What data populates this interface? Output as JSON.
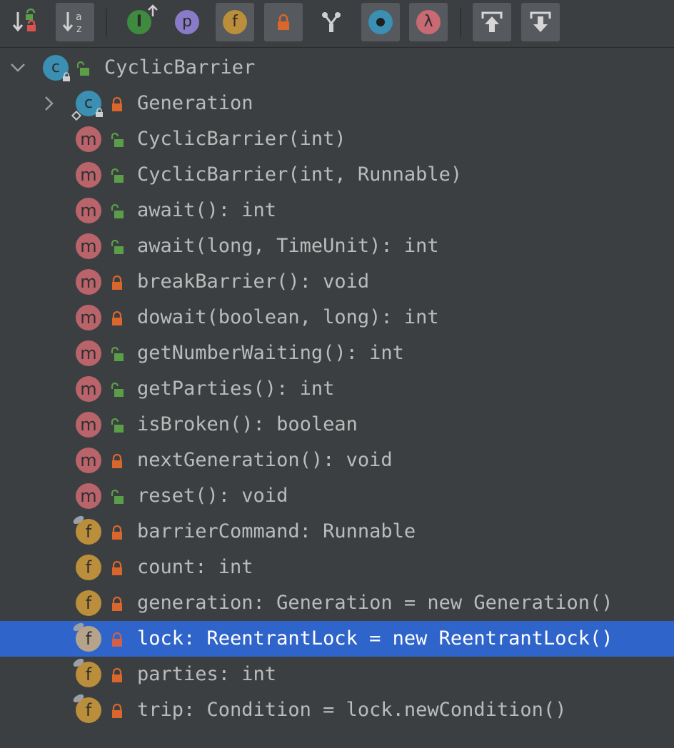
{
  "toolbar": {
    "buttons": [
      {
        "name": "sort-by-visibility-button",
        "icon": "sort-visibility-icon",
        "active": false
      },
      {
        "name": "sort-alphabetically-button",
        "icon": "sort-alpha-icon",
        "label": "a z",
        "active": true
      },
      {
        "name": "show-inherited-button",
        "icon": "inherited-icon",
        "label": "I",
        "active": false
      },
      {
        "name": "show-properties-button",
        "icon": "property-icon",
        "label": "p",
        "active": false
      },
      {
        "name": "show-fields-button",
        "icon": "field-icon",
        "label": "f",
        "active": true
      },
      {
        "name": "show-non-public-button",
        "icon": "lock-icon",
        "active": true
      },
      {
        "name": "show-inherited-members-button",
        "icon": "hierarchy-icon",
        "active": false
      },
      {
        "name": "show-anonymous-classes-button",
        "icon": "anonymous-class-icon",
        "active": true
      },
      {
        "name": "show-lambdas-button",
        "icon": "lambda-icon",
        "label": "λ",
        "active": true
      },
      {
        "name": "expand-all-button",
        "icon": "expand-up-icon",
        "active": true
      },
      {
        "name": "collapse-all-button",
        "icon": "collapse-down-icon",
        "active": true
      }
    ]
  },
  "colors": {
    "background": "#3c3f41",
    "selection": "#2f65ca",
    "method": "#b9636a",
    "field": "#ba8e3a",
    "class": "#3b8fb3",
    "public_lock": "#5b9e48",
    "private_lock": "#d9662c"
  },
  "tree": {
    "root": {
      "label": "CyclicBarrier",
      "kind": "class",
      "visibility": "public",
      "expanded": true
    },
    "items": [
      {
        "label": "Generation",
        "kind": "class",
        "visibility": "private",
        "collapsed": true
      },
      {
        "label": "CyclicBarrier(int)",
        "kind": "method",
        "visibility": "public"
      },
      {
        "label": "CyclicBarrier(int, Runnable)",
        "kind": "method",
        "visibility": "public"
      },
      {
        "label": "await(): int",
        "kind": "method",
        "visibility": "public"
      },
      {
        "label": "await(long, TimeUnit): int",
        "kind": "method",
        "visibility": "public"
      },
      {
        "label": "breakBarrier(): void",
        "kind": "method",
        "visibility": "private"
      },
      {
        "label": "dowait(boolean, long): int",
        "kind": "method",
        "visibility": "private"
      },
      {
        "label": "getNumberWaiting(): int",
        "kind": "method",
        "visibility": "public"
      },
      {
        "label": "getParties(): int",
        "kind": "method",
        "visibility": "public"
      },
      {
        "label": "isBroken(): boolean",
        "kind": "method",
        "visibility": "public"
      },
      {
        "label": "nextGeneration(): void",
        "kind": "method",
        "visibility": "private"
      },
      {
        "label": "reset(): void",
        "kind": "method",
        "visibility": "public"
      },
      {
        "label": "barrierCommand: Runnable",
        "kind": "field",
        "visibility": "private",
        "final": true
      },
      {
        "label": "count: int",
        "kind": "field",
        "visibility": "private"
      },
      {
        "label": "generation: Generation = new Generation()",
        "kind": "field",
        "visibility": "private"
      },
      {
        "label": "lock: ReentrantLock = new ReentrantLock()",
        "kind": "field",
        "visibility": "private",
        "final": true,
        "selected": true
      },
      {
        "label": "parties: int",
        "kind": "field",
        "visibility": "private",
        "final": true
      },
      {
        "label": "trip: Condition = lock.newCondition()",
        "kind": "field",
        "visibility": "private",
        "final": true
      }
    ]
  }
}
